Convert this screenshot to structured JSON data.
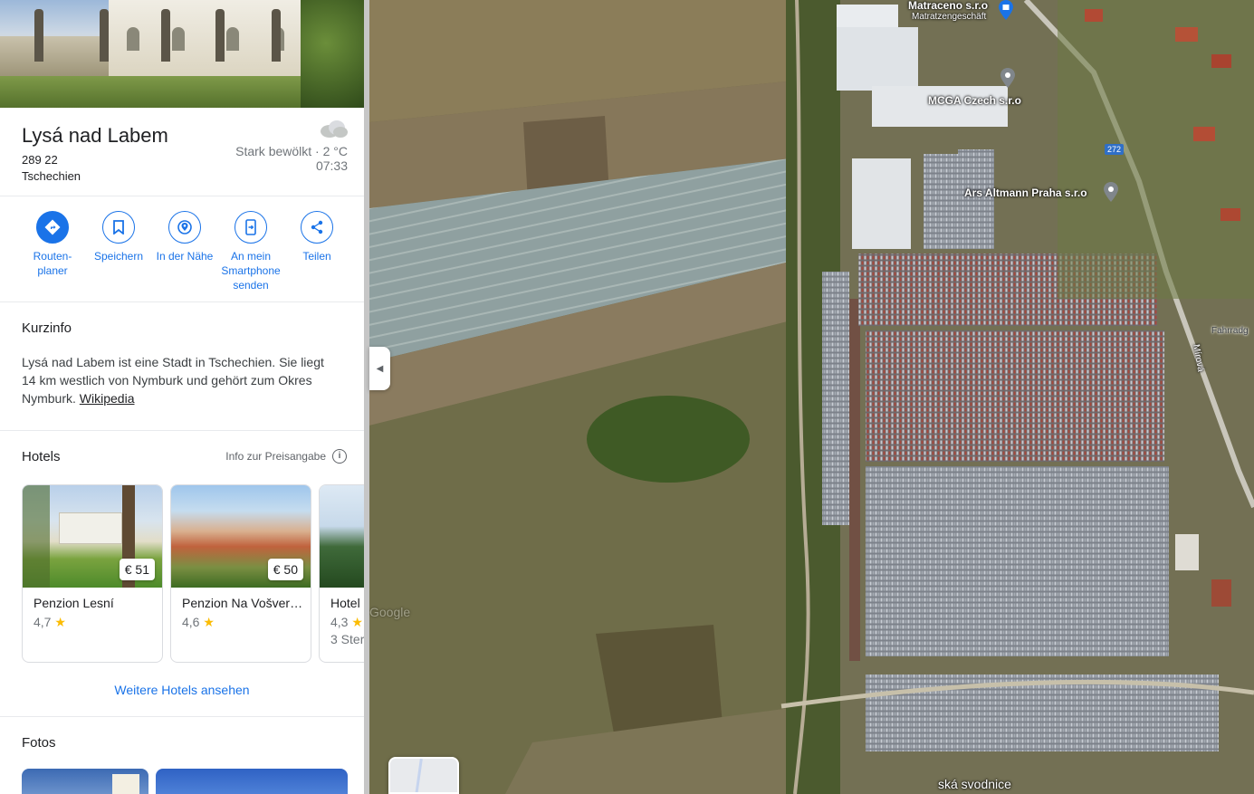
{
  "place": {
    "title": "Lysá nad Labem",
    "zip": "289 22",
    "country": "Tschechien",
    "weather_desc": "Stark bewölkt · 2 °C",
    "weather_time": "07:33",
    "weather_icon": "cloud-icon"
  },
  "actions": [
    {
      "label": "Routen-\nplaner",
      "icon": "directions-icon"
    },
    {
      "label": "Speichern",
      "icon": "bookmark-icon"
    },
    {
      "label": "In der Nähe",
      "icon": "nearby-icon"
    },
    {
      "label": "An mein Smartphone senden",
      "icon": "phone-icon"
    },
    {
      "label": "Teilen",
      "icon": "share-icon"
    }
  ],
  "kurzinfo": {
    "title": "Kurzinfo",
    "text": "Lysá nad Labem ist eine Stadt in Tschechien. Sie liegt 14 km westlich von Nymburk und gehört zum Okres Nymburk.",
    "link": "Wikipedia"
  },
  "hotels": {
    "title": "Hotels",
    "price_info": "Info zur Preisangabe",
    "more": "Weitere Hotels ansehen",
    "items": [
      {
        "name": "Penzion Lesní",
        "price": "€ 51",
        "rating": "4,7",
        "extra": ""
      },
      {
        "name": "Penzion Na Vošver…",
        "price": "€ 50",
        "rating": "4,6",
        "extra": ""
      },
      {
        "name": "Hotel",
        "price": "",
        "rating": "4,3",
        "extra": "3 Ster"
      }
    ]
  },
  "fotos": {
    "title": "Fotos"
  },
  "map": {
    "labels": {
      "matraceno": "Matraceno s.r.o",
      "matratzen": "Matratzengeschäft",
      "mcga": "MCGA Czech s.r.o",
      "ars": "Ars Altmann Praha s.r.o",
      "road272": "272",
      "mirova": "Mírová",
      "fahrrad": "Fahrradg",
      "svodnice": "ská svodnice",
      "google": "Google"
    }
  },
  "colors": {
    "accent": "#1a73e8",
    "star": "#fbbc04"
  }
}
